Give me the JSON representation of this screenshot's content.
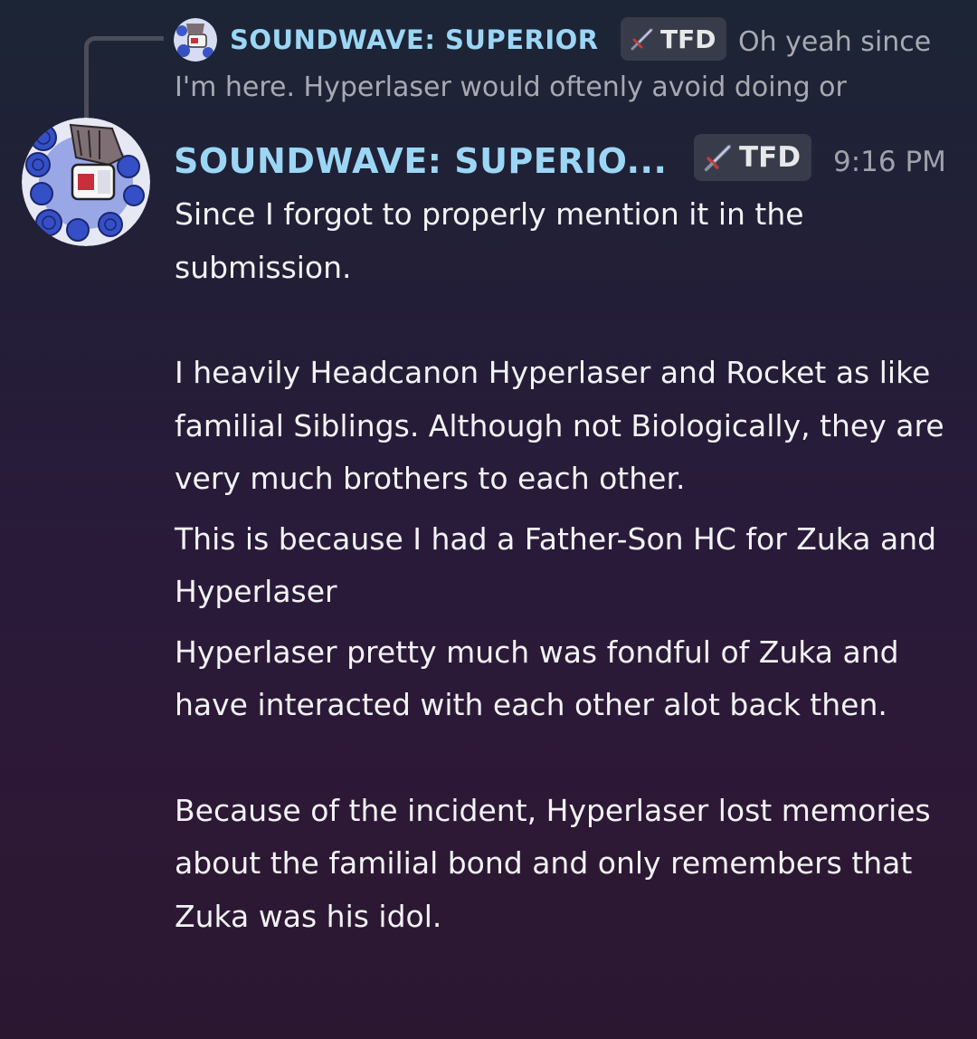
{
  "reply": {
    "author": "SOUNDWAVE: SUPERIOR",
    "tag": "TFD",
    "tag_icon": "sword-icon",
    "text": "Oh yeah since I'm here.   Hyperlaser would oftenly avoid doing or"
  },
  "message": {
    "author": "SOUNDWAVE: SUPERIO...",
    "tag": "TFD",
    "tag_icon": "sword-icon",
    "timestamp": "9:16 PM",
    "paragraphs": [
      "Since I forgot to properly mention it in the submission.",
      "I heavily Headcanon Hyperlaser and Rocket as like familial Siblings. Although not Biologically, they are very much brothers to each other.",
      "This is because I had a Father-Son HC for Zuka and Hyperlaser",
      "Hyperlaser pretty much was fondful of Zuka and have interacted with each other alot back then.",
      "Because of the incident, Hyperlaser lost memories about the familial bond and only remembers that Zuka was his idol."
    ]
  },
  "colors": {
    "author_name": "#9cd6f5",
    "tag_background": "#383b49",
    "body_text": "#f2f3f5",
    "muted_text": "#a8a9b2"
  }
}
